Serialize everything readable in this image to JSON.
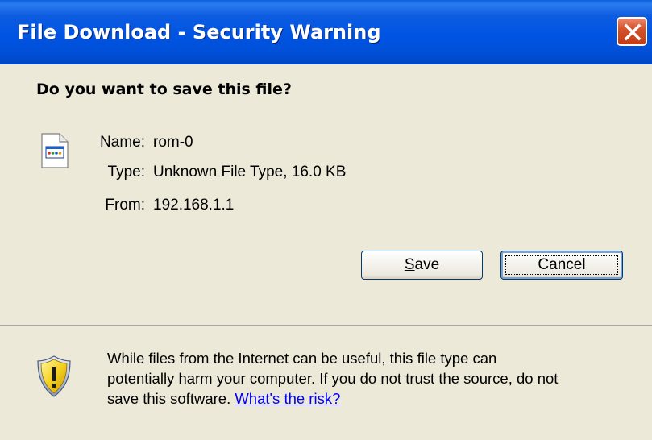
{
  "window": {
    "title": "File Download - Security Warning"
  },
  "dialog": {
    "question": "Do you want to save this file?",
    "file": {
      "name_label": "Name:",
      "name_value": "rom-0",
      "type_label": "Type:",
      "type_value": "Unknown File Type, 16.0 KB",
      "from_label": "From:",
      "from_value": "192.168.1.1"
    },
    "buttons": {
      "save_label": "Save",
      "save_mnemonic": "S",
      "save_rest": "ave",
      "cancel_label": "Cancel"
    },
    "warning": {
      "line1": "While files from the Internet can be useful, this file type can",
      "line2": "potentially harm your computer. If you do not trust the source, do not",
      "line3_prefix": "save this software. ",
      "risk_link": "What's the risk?"
    }
  },
  "colors": {
    "titlebar": "#0054e3",
    "dialog_background": "#ece9d8",
    "close_button": "#d6522c",
    "link": "#0000ff"
  },
  "icons": {
    "close": "close-icon",
    "file": "generic-file-icon",
    "warning": "security-shield-icon"
  }
}
